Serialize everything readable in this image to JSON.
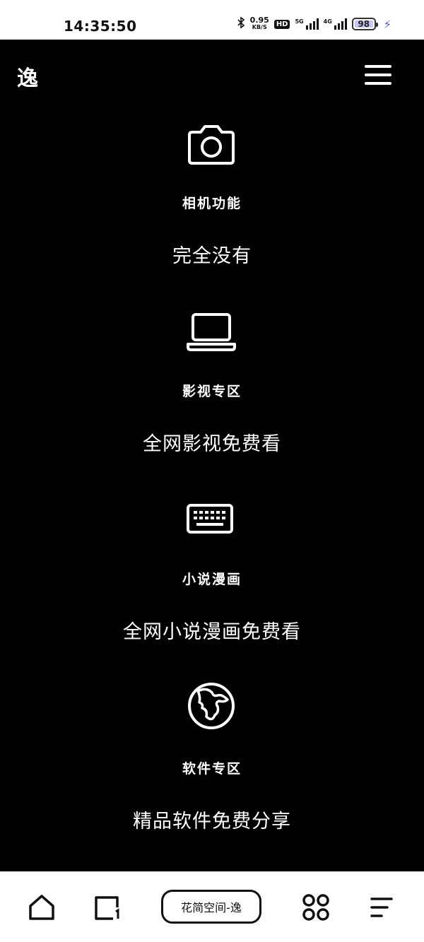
{
  "status_bar": {
    "time": "14:35:50",
    "net_speed": "0.95",
    "net_unit": "KB/S",
    "hd_badge": "HD",
    "network_5g": "5G",
    "network_4g": "4G",
    "battery_level": "98"
  },
  "header": {
    "logo": "逸"
  },
  "features": [
    {
      "icon": "camera-icon",
      "title": "相机功能",
      "desc": "完全没有"
    },
    {
      "icon": "laptop-icon",
      "title": "影视专区",
      "desc": "全网影视免费看"
    },
    {
      "icon": "keyboard-icon",
      "title": "小说漫画",
      "desc": "全网小说漫画免费看"
    },
    {
      "icon": "globe-icon",
      "title": "软件专区",
      "desc": "精品软件免费分享"
    }
  ],
  "bottom_nav": {
    "center_tab": "花简空间-逸"
  },
  "colors": {
    "background": "#000000",
    "foreground": "#ffffff",
    "battery_fill": "#c8c6f5",
    "charging_bolt": "#4a56e2"
  }
}
